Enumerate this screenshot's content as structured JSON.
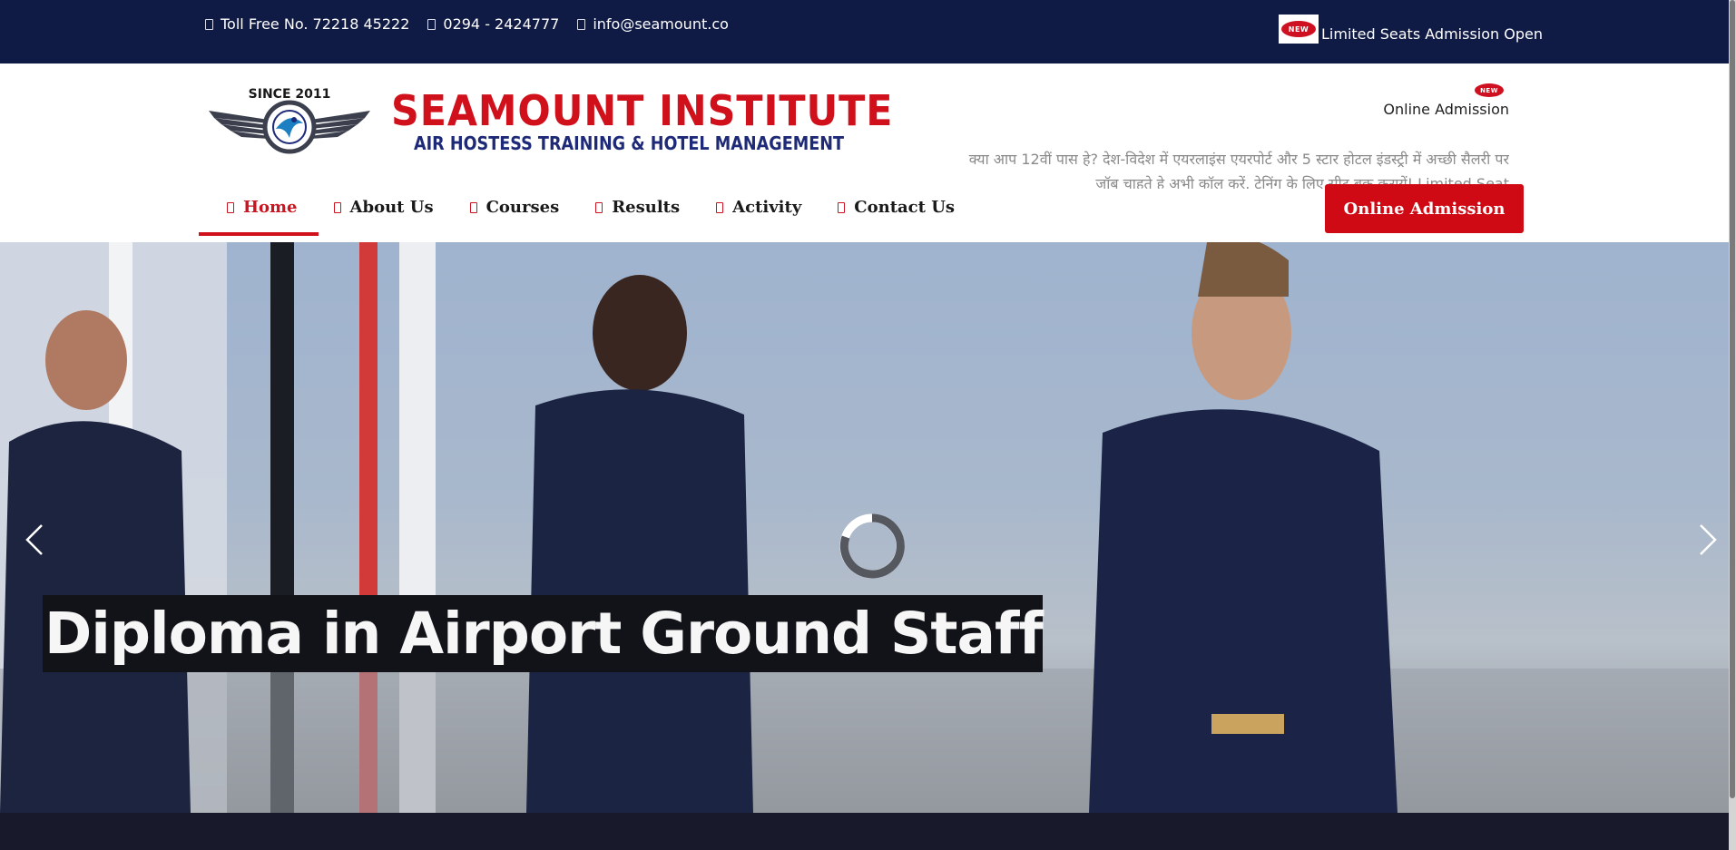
{
  "topbar": {
    "phone_toll_free": "Toll Free No. 72218 45222",
    "phone_local": "0294 - 2424777",
    "email": "info@seamount.co",
    "new_badge": "NEW",
    "admission_notice": "Limited Seats Admission Open"
  },
  "header": {
    "logo": {
      "since": "SINCE 2011",
      "title": "SEAMOUNT INSTITUTE",
      "subtitle": "AIR HOSTESS TRAINING & HOTEL MANAGEMENT"
    },
    "online_admission_badge": "NEW",
    "online_admission_link": "Online Admission",
    "marquee_text": "क्या आप 12वीं पास हे? देश-विदेश में एयरलाइंस एयरपोर्ट और 5 स्टार होटल इंडस्ट्री में अच्छी सैलरी पर जॉब चाहते हे अभी कॉल करें, ट्रेनिंग के लिए सीट बुक करायें! Limited Seat"
  },
  "nav": {
    "items": [
      {
        "label": "Home",
        "icon": "home-icon",
        "active": true
      },
      {
        "label": "About Us",
        "icon": "info-icon",
        "active": false
      },
      {
        "label": "Courses",
        "icon": "book-icon",
        "active": false
      },
      {
        "label": "Results",
        "icon": "trophy-icon",
        "active": false
      },
      {
        "label": "Activity",
        "icon": "calendar-icon",
        "active": false
      },
      {
        "label": "Contact Us",
        "icon": "phone-icon",
        "active": false
      }
    ],
    "cta_label": "Online Admission"
  },
  "hero": {
    "caption": "Diploma in Airport Ground Staff"
  },
  "colors": {
    "topbar_bg": "#0f1a45",
    "brand_red": "#d0111c",
    "brand_blue": "#1e2a78",
    "cta_bg": "#cf0a14",
    "footer_strip": "#181a2b"
  }
}
